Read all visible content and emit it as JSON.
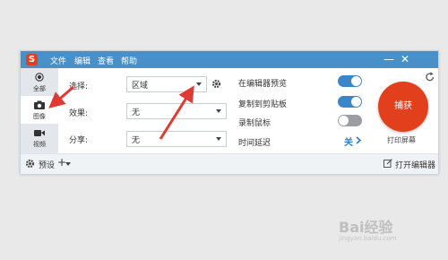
{
  "app": {
    "logo": "S",
    "menu": [
      "文件",
      "编辑",
      "查看",
      "帮助"
    ],
    "window_buttons": {
      "minimize": "—",
      "close": "✕"
    }
  },
  "sidebar": {
    "items": [
      {
        "label": "全部",
        "icon": "all-circle-icon",
        "active": false
      },
      {
        "label": "图像",
        "icon": "camera-icon",
        "active": true
      },
      {
        "label": "视频",
        "icon": "video-camera-icon",
        "active": false
      }
    ]
  },
  "settings": {
    "selection": {
      "label": "选择:",
      "value": "区域"
    },
    "effect": {
      "label": "效果:",
      "value": "无"
    },
    "share": {
      "label": "分享:",
      "value": "无"
    }
  },
  "options": {
    "preview_in_editor": {
      "label": "在编辑器预览",
      "on": true
    },
    "copy_to_clipboard": {
      "label": "复制到剪贴板",
      "on": true
    },
    "record_cursor": {
      "label": "录制鼠标",
      "on": false
    },
    "time_delay": {
      "label": "时间延迟",
      "value": "关"
    }
  },
  "capture": {
    "button_label": "捕获",
    "sub_label": "打印屏幕"
  },
  "footer": {
    "presets_label": "预设",
    "add_label": "+",
    "open_editor_label": "打开编辑器"
  },
  "watermark": {
    "text": "Bai经验",
    "url": "jingyan.baidu.com"
  },
  "colors": {
    "titlebar": "#4a90c8",
    "capture": "#e2401c",
    "toggle_on": "#3a86c8",
    "annotation": "#e03a32"
  }
}
